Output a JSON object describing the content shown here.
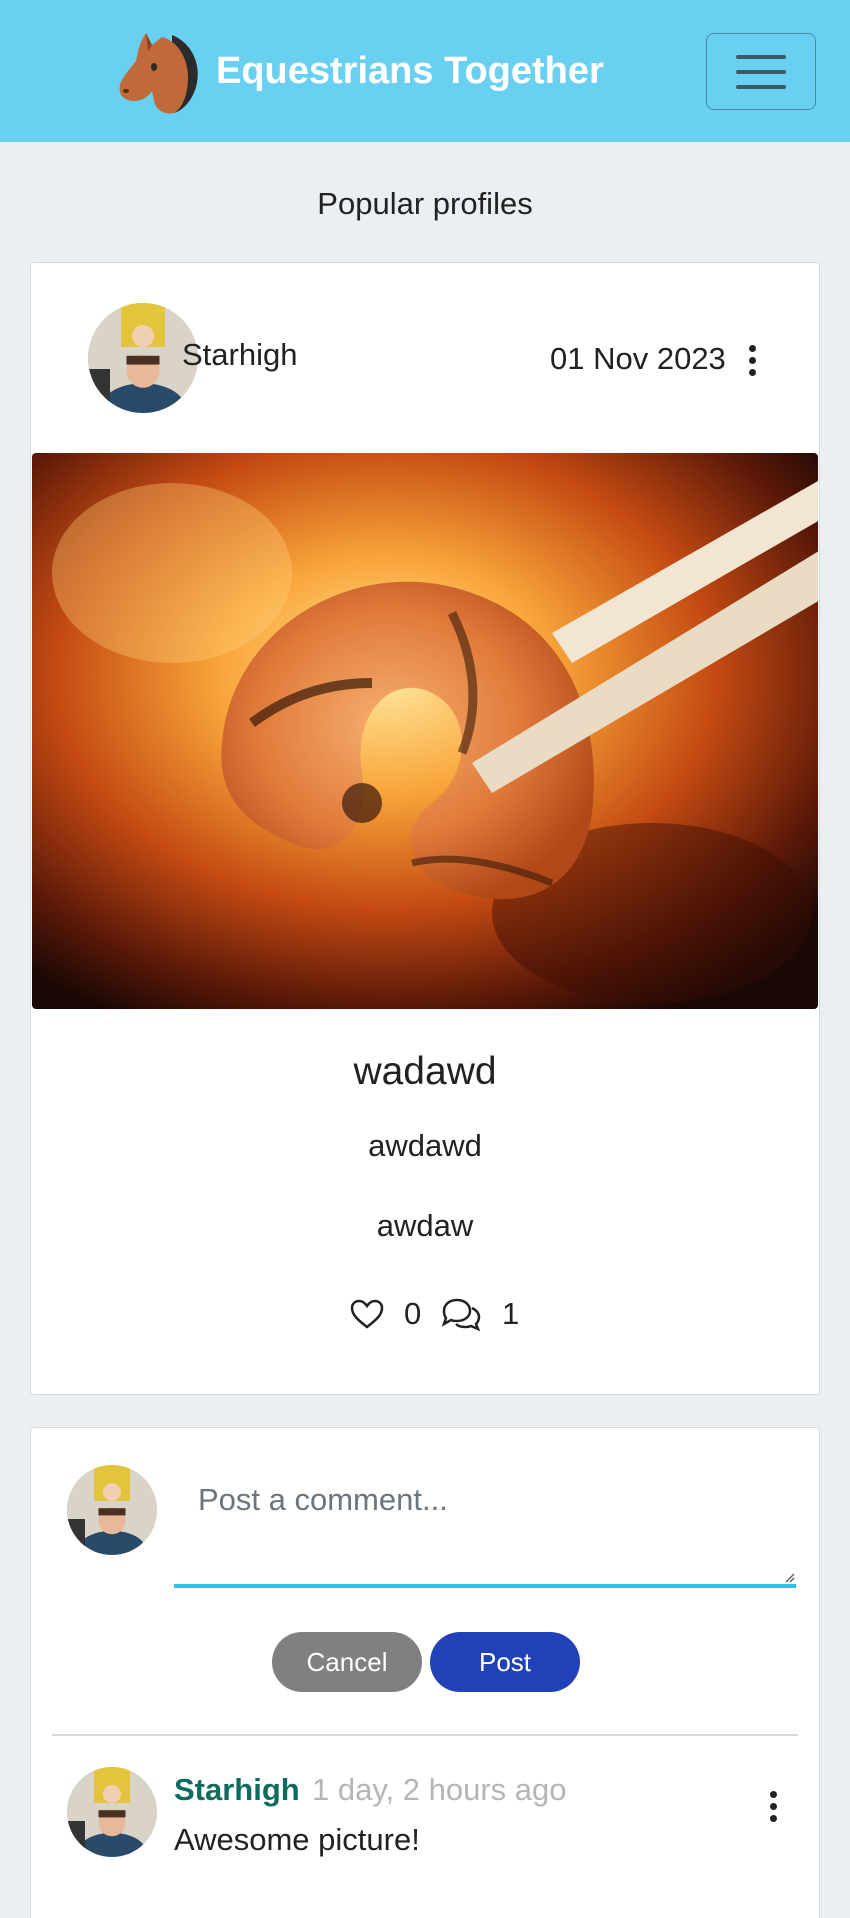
{
  "navbar": {
    "brand": "Equestrians Together",
    "logo_icon": "horse-head-icon",
    "menu_icon": "hamburger-menu-icon",
    "background": "#6ad0f2"
  },
  "popular": {
    "heading": "Popular profiles"
  },
  "post": {
    "owner": "Starhigh",
    "date": "01 Nov 2023",
    "title": "wadawd",
    "content": "awdawd",
    "extra": "awdaw",
    "likes": "0",
    "comments": "1",
    "like_icon": "heart-outline-icon",
    "comment_icon": "chat-bubbles-icon"
  },
  "comment_form": {
    "placeholder": "Post a comment...",
    "cancel_label": "Cancel",
    "post_label": "Post",
    "accent": "#29c6e9",
    "post_button_color": "#2142b6"
  },
  "comments": [
    {
      "owner": "Starhigh",
      "time": "1 day, 2 hours ago",
      "text": "Awesome picture!",
      "owner_color": "#0e6b5e"
    }
  ]
}
